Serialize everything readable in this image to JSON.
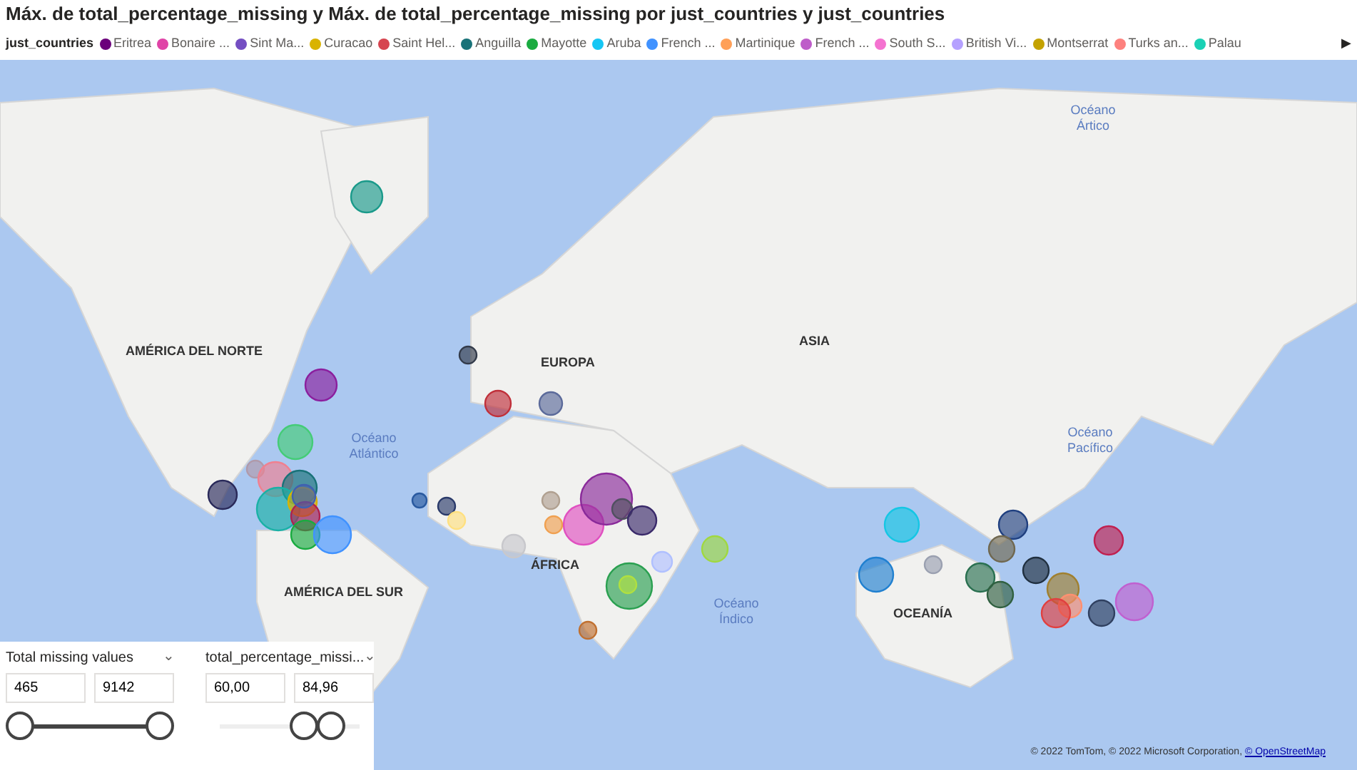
{
  "title": "Máx. de total_percentage_missing y Máx. de total_percentage_missing por just_countries y just_countries",
  "legend": {
    "label": "just_countries",
    "next_arrow": "▶",
    "items": [
      {
        "name": "Eritrea",
        "color": "#6b007b"
      },
      {
        "name": "Bonaire ...",
        "color": "#e044a7"
      },
      {
        "name": "Sint Ma...",
        "color": "#744ec2"
      },
      {
        "name": "Curacao",
        "color": "#d9b300"
      },
      {
        "name": "Saint Hel...",
        "color": "#d64550"
      },
      {
        "name": "Anguilla",
        "color": "#197278"
      },
      {
        "name": "Mayotte",
        "color": "#1aab40"
      },
      {
        "name": "Aruba",
        "color": "#15c6f4"
      },
      {
        "name": "French ...",
        "color": "#4092ff"
      },
      {
        "name": "Martinique",
        "color": "#ffa058"
      },
      {
        "name": "French ...",
        "color": "#be5dc9"
      },
      {
        "name": "South S...",
        "color": "#f472d0"
      },
      {
        "name": "British Vi...",
        "color": "#b5a1ff"
      },
      {
        "name": "Montserrat",
        "color": "#c4a200"
      },
      {
        "name": "Turks an...",
        "color": "#fd817e"
      },
      {
        "name": "Palau",
        "color": "#1ad1b5"
      }
    ]
  },
  "map": {
    "labels": [
      {
        "text": "AMÉRICA DEL NORTE",
        "kind": "continent"
      },
      {
        "text": "EUROPA",
        "kind": "continent"
      },
      {
        "text": "ASIA",
        "kind": "continent"
      },
      {
        "text": "ÁFRICA",
        "kind": "continent"
      },
      {
        "text": "AMÉRICA DEL SUR",
        "kind": "continent"
      },
      {
        "text": "OCEANÍA",
        "kind": "continent"
      },
      {
        "text": "Océano Ártico",
        "kind": "ocean"
      },
      {
        "text": "Océano Atlántico",
        "kind": "ocean"
      },
      {
        "text": "Océano Pacífico",
        "kind": "ocean"
      },
      {
        "text": "Océano Índico",
        "kind": "ocean"
      }
    ],
    "attribution": "© 2022 TomTom, © 2022 Microsoft Corporation, ",
    "attribution_link": "© OpenStreetMap"
  },
  "slicers": [
    {
      "title": "Total missing values",
      "caret": "⌄",
      "min_value": "465",
      "max_value": "9142",
      "thumbs": [
        {
          "level": 0
        },
        {
          "level": 1
        }
      ]
    },
    {
      "title": "total_percentage_missi...",
      "caret": "⌄",
      "min_value": "60,00",
      "max_value": "84,96",
      "thumbs": [
        {
          "level": 0.6
        },
        {
          "level": 0.8
        }
      ]
    }
  ]
}
